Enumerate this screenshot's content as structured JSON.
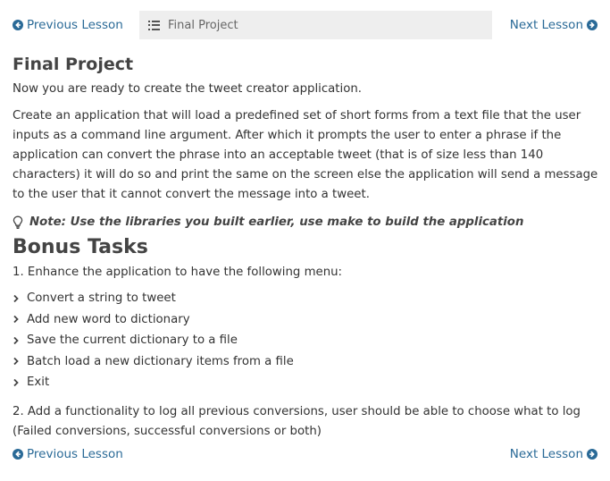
{
  "nav": {
    "prev_label": "Previous Lesson",
    "next_label": "Next Lesson",
    "breadcrumb_label": "Final Project",
    "breadcrumb_icon": "list-icon",
    "prev_icon": "arrow-circle-left-icon",
    "next_icon": "arrow-circle-right-icon",
    "link_color": "#2a6a97"
  },
  "content": {
    "title": "Final Project",
    "intro": "Now you are ready to create the tweet creator application.",
    "description": "Create an application that will load a predefined set of short forms from a text file that the user inputs as a command line argument. After which it prompts the user to enter a phrase if the application can convert the phrase into an acceptable tweet (that is of size less than 140 characters) it will do so and print the same on the screen else the application will send a message to the user that it cannot convert the message into a tweet.",
    "note": "Note: Use the libraries you built earlier, use make to build the application",
    "note_icon": "lightbulb-icon"
  },
  "bonus": {
    "title": "Bonus Tasks",
    "task1": "1. Enhance the application to have the following menu:",
    "menu_items": [
      "Convert a string to tweet",
      "Add new word to dictionary",
      "Save the current dictionary to a file",
      "Batch load a new dictionary items from a file",
      "Exit"
    ],
    "task2": "2. Add a functionality to log all previous conversions, user should be able to choose what to log (Failed conversions, successful conversions or both)"
  }
}
